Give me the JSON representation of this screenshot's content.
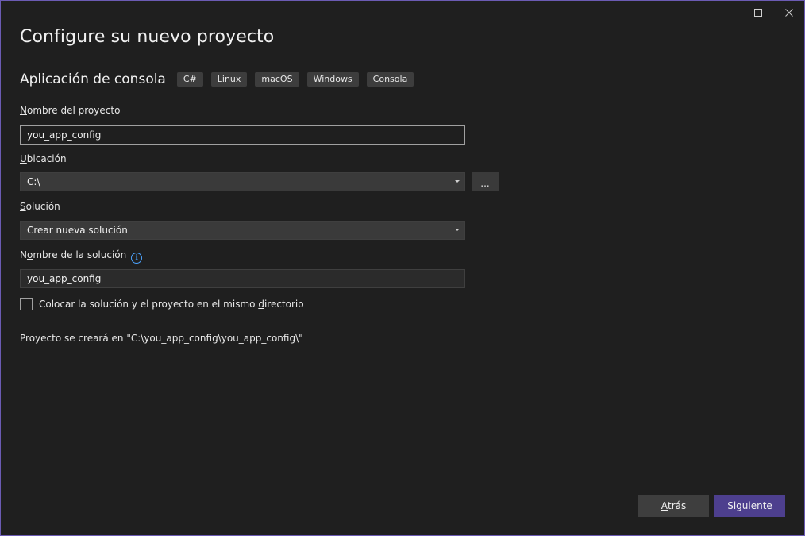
{
  "window": {
    "title": "Configure su nuevo proyecto"
  },
  "template": {
    "name": "Aplicación de consola",
    "tags": [
      "C#",
      "Linux",
      "macOS",
      "Windows",
      "Consola"
    ]
  },
  "project_name": {
    "label_acc": "N",
    "label_rest": "ombre del proyecto",
    "value": "you_app_config"
  },
  "location": {
    "label_acc": "U",
    "label_rest": "bicación",
    "value": "C:\\",
    "browse_label": "..."
  },
  "solution": {
    "label_acc": "S",
    "label_rest": "olución",
    "value": "Crear nueva solución"
  },
  "solution_name": {
    "label_pre": "N",
    "label_acc": "o",
    "label_rest": "mbre de la solución",
    "value": "you_app_config"
  },
  "same_dir": {
    "label_pre": "Colocar la solución y el proyecto en el mismo ",
    "label_acc": "d",
    "label_rest": "irectorio",
    "checked": false
  },
  "path_info": "Proyecto se creará en \"C:\\you_app_config\\you_app_config\\\"",
  "buttons": {
    "back_acc": "A",
    "back_rest": "trás",
    "next": "Siguiente"
  },
  "colors": {
    "accent": "#4d3f8e",
    "window_border": "#6b5bb3",
    "info": "#4ba3ff"
  }
}
